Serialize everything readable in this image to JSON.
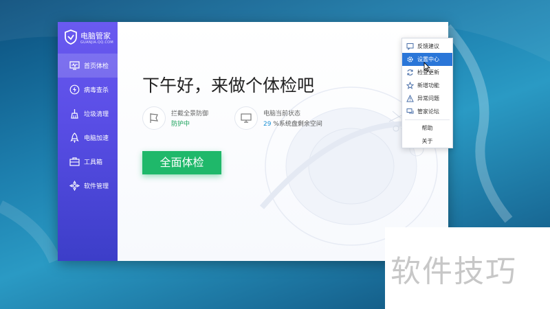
{
  "app": {
    "brand_name": "电脑管家",
    "brand_url": "GUANJIA.QQ.COM"
  },
  "sidebar": {
    "items": [
      {
        "label": "首页体检",
        "icon": "monitor-pulse-icon",
        "active": true
      },
      {
        "label": "病毒查杀",
        "icon": "lightning-shield-icon",
        "active": false
      },
      {
        "label": "垃圾清理",
        "icon": "broom-icon",
        "active": false
      },
      {
        "label": "电脑加速",
        "icon": "rocket-icon",
        "active": false
      },
      {
        "label": "工具箱",
        "icon": "toolbox-icon",
        "active": false
      },
      {
        "label": "软件管理",
        "icon": "apps-icon",
        "active": false
      }
    ]
  },
  "main": {
    "greeting": "下午好，来做个体检吧",
    "protection": {
      "title": "拦截全景防御",
      "value": "防护中"
    },
    "pc_status": {
      "title": "电脑当前状态",
      "percent": "29",
      "suffix": " %系统盘剩余空间"
    },
    "scan_button": "全面体检"
  },
  "menu": {
    "items": [
      {
        "label": "反馈建议",
        "icon": "feedback-icon"
      },
      {
        "label": "设置中心",
        "icon": "gear-icon",
        "active": true
      },
      {
        "label": "检查更新",
        "icon": "refresh-icon"
      },
      {
        "label": "新增功能",
        "icon": "star-icon"
      },
      {
        "label": "异常问题",
        "icon": "warning-icon"
      },
      {
        "label": "管家论坛",
        "icon": "forum-icon"
      },
      {
        "label": "帮助"
      },
      {
        "label": "关于"
      }
    ]
  },
  "watermark": "软件技巧",
  "colors": {
    "sidebar_top": "#6a5af0",
    "sidebar_bottom": "#3c3ec8",
    "scan_button": "#1fb86a",
    "menu_highlight": "#2a76d8",
    "protection_status": "#1aa15a"
  }
}
